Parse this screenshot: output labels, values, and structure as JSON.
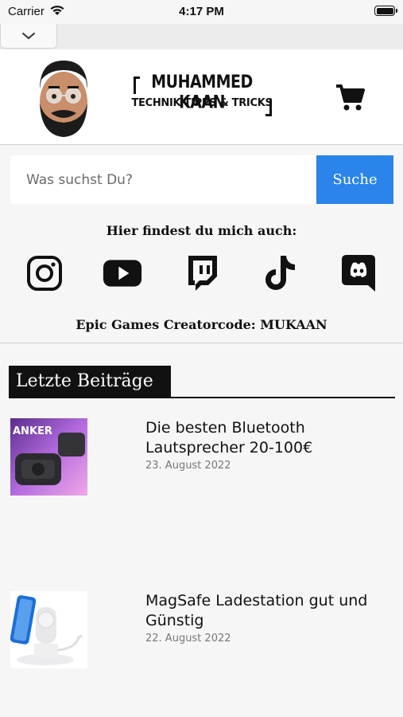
{
  "status": {
    "carrier": "Carrier",
    "time": "4:17 PM"
  },
  "header": {
    "logo_line1": "MUHAMMED KAAN",
    "logo_line2": "TECHNIK TIPPS & TRICKS"
  },
  "search": {
    "placeholder": "Was suchst Du?",
    "button": "Suche"
  },
  "social": {
    "title": "Hier findest du mich auch:",
    "icons": [
      "instagram-icon",
      "youtube-icon",
      "twitch-icon",
      "tiktok-icon",
      "discord-icon"
    ]
  },
  "creator_code": "Epic Games Creatorcode: MUKAAN",
  "section": {
    "title": "Letzte Beiträge"
  },
  "posts": [
    {
      "title": "Die besten Bluetooth Lautsprecher 20-100€",
      "date": "23. August 2022",
      "thumb_brand": "ANKER"
    },
    {
      "title": "MagSafe Ladestation gut und Günstig",
      "date": "22. August 2022"
    }
  ],
  "colors": {
    "accent": "#2a84ea",
    "background": "#f6f6f6",
    "dark": "#111111"
  }
}
